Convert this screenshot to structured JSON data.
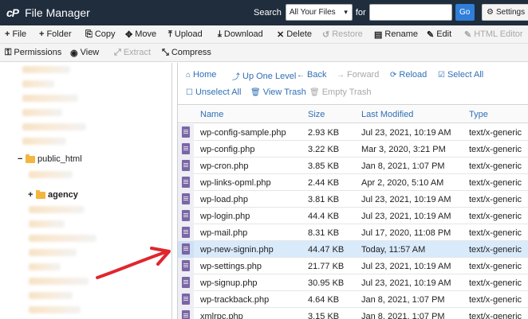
{
  "header": {
    "logo": "cP",
    "title": "File Manager",
    "search_label": "Search",
    "search_scope": "All Your Files",
    "for_label": "for",
    "search_value": "",
    "go_label": "Go",
    "settings_label": "Settings"
  },
  "toolbar": {
    "items": [
      {
        "icon": "+",
        "label": "File",
        "enabled": true
      },
      {
        "icon": "+",
        "label": "Folder",
        "enabled": true
      },
      {
        "icon": "⎘",
        "label": "Copy",
        "enabled": true
      },
      {
        "icon": "✥",
        "label": "Move",
        "enabled": true
      },
      {
        "icon": "⤒",
        "label": "Upload",
        "enabled": true
      },
      {
        "icon": "⤓",
        "label": "Download",
        "enabled": true
      },
      {
        "icon": "✕",
        "label": "Delete",
        "enabled": true
      },
      {
        "icon": "↺",
        "label": "Restore",
        "enabled": false
      },
      {
        "icon": "▤",
        "label": "Rename",
        "enabled": true
      },
      {
        "icon": "✎",
        "label": "Edit",
        "enabled": true
      },
      {
        "icon": "✎",
        "label": "HTML Editor",
        "enabled": false
      },
      {
        "icon": "⚿",
        "label": "Permissions",
        "enabled": true
      },
      {
        "icon": "◉",
        "label": "View",
        "enabled": true
      },
      {
        "icon": "⤢",
        "label": "Extract",
        "enabled": false
      },
      {
        "icon": "⤡",
        "label": "Compress",
        "enabled": true
      }
    ]
  },
  "tree": {
    "public_html": "public_html",
    "agency": "agency"
  },
  "nav": {
    "home": "Home",
    "up": "Up One Level",
    "back": "Back",
    "forward": "Forward",
    "reload": "Reload",
    "select_all": "Select All",
    "unselect_all": "Unselect All",
    "view_trash": "View Trash",
    "empty_trash": "Empty Trash"
  },
  "table": {
    "columns": [
      "Name",
      "Size",
      "Last Modified",
      "Type"
    ],
    "rows": [
      {
        "name": "wp-config-sample.php",
        "size": "2.93 KB",
        "modified": "Jul 23, 2021, 10:19 AM",
        "type": "text/x-generic",
        "selected": false
      },
      {
        "name": "wp-config.php",
        "size": "3.22 KB",
        "modified": "Mar 3, 2020, 3:21 PM",
        "type": "text/x-generic",
        "selected": false
      },
      {
        "name": "wp-cron.php",
        "size": "3.85 KB",
        "modified": "Jan 8, 2021, 1:07 PM",
        "type": "text/x-generic",
        "selected": false
      },
      {
        "name": "wp-links-opml.php",
        "size": "2.44 KB",
        "modified": "Apr 2, 2020, 5:10 AM",
        "type": "text/x-generic",
        "selected": false
      },
      {
        "name": "wp-load.php",
        "size": "3.81 KB",
        "modified": "Jul 23, 2021, 10:19 AM",
        "type": "text/x-generic",
        "selected": false
      },
      {
        "name": "wp-login.php",
        "size": "44.4 KB",
        "modified": "Jul 23, 2021, 10:19 AM",
        "type": "text/x-generic",
        "selected": false
      },
      {
        "name": "wp-mail.php",
        "size": "8.31 KB",
        "modified": "Jul 17, 2020, 11:08 PM",
        "type": "text/x-generic",
        "selected": false
      },
      {
        "name": "wp-new-signin.php",
        "size": "44.47 KB",
        "modified": "Today, 11:57 AM",
        "type": "text/x-generic",
        "selected": true
      },
      {
        "name": "wp-settings.php",
        "size": "21.77 KB",
        "modified": "Jul 23, 2021, 10:19 AM",
        "type": "text/x-generic",
        "selected": false
      },
      {
        "name": "wp-signup.php",
        "size": "30.95 KB",
        "modified": "Jul 23, 2021, 10:19 AM",
        "type": "text/x-generic",
        "selected": false
      },
      {
        "name": "wp-trackback.php",
        "size": "4.64 KB",
        "modified": "Jan 8, 2021, 1:07 PM",
        "type": "text/x-generic",
        "selected": false
      },
      {
        "name": "xmlrpc.php",
        "size": "3.15 KB",
        "modified": "Jan 8, 2021, 1:07 PM",
        "type": "text/x-generic",
        "selected": false
      }
    ]
  },
  "colors": {
    "header_bg": "#1f2d3d",
    "link_blue": "#2f6fb5",
    "selected_row": "#d9eafb",
    "annotation_arrow": "#e0262e"
  }
}
